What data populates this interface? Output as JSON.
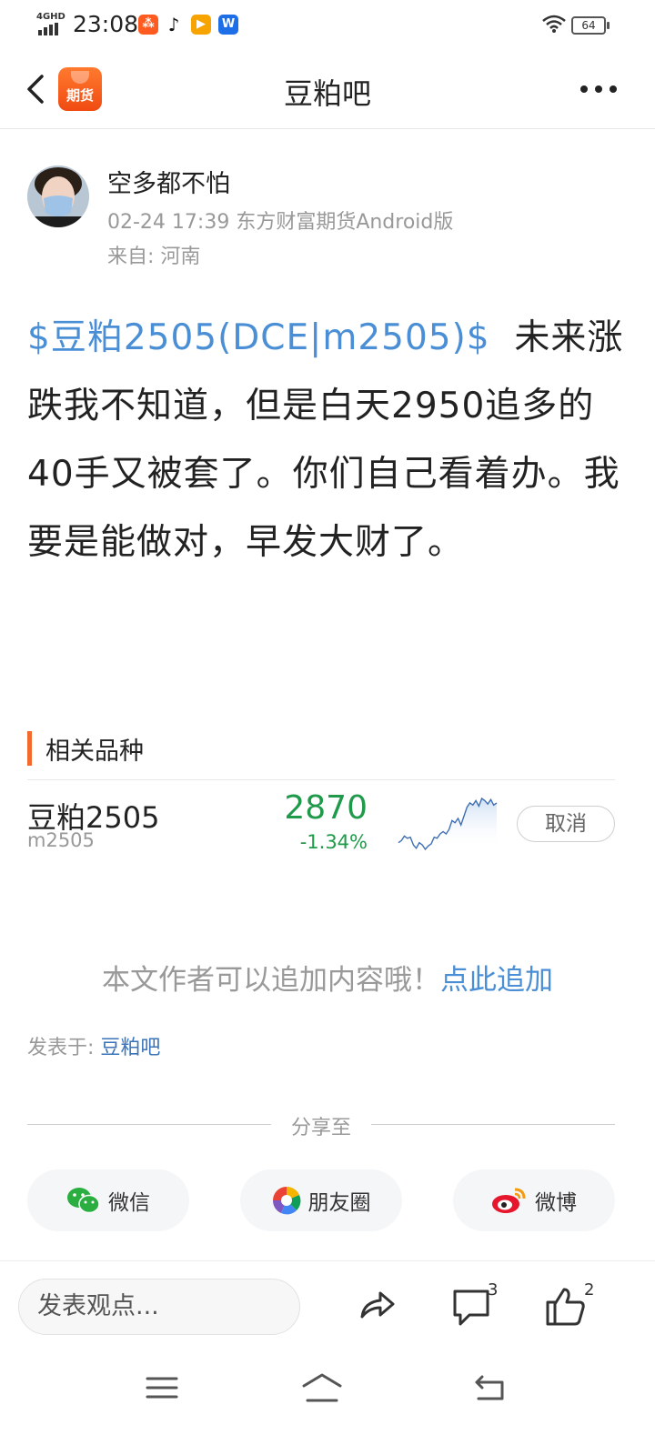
{
  "status_bar": {
    "network": "4GHD",
    "time": "23:08",
    "battery": "64",
    "apps": [
      {
        "name": "kuaishou-icon",
        "glyph": "⁂",
        "color": "#ff5a1f"
      },
      {
        "name": "tiktok-icon",
        "glyph": "♪",
        "color": "#111111"
      },
      {
        "name": "video-app-icon",
        "glyph": "▶",
        "color": "#f7a400"
      },
      {
        "name": "w-app-icon",
        "glyph": "W",
        "color": "#1e6ee8"
      }
    ]
  },
  "header": {
    "title": "豆粕吧",
    "logo_text": "期货"
  },
  "post": {
    "author": "空多都不怕",
    "meta": "02-24 17:39 东方财富期货Android版",
    "location": "来自: 河南",
    "stock_link": "$豆粕2505(DCE|m2505)$",
    "content": "未来涨跌我不知道，但是白天2950追多的40手又被套了。你们自己看着办。我要是能做对，早发大财了。"
  },
  "related": {
    "title": "相关品种",
    "name": "豆粕2505",
    "code": "m2505",
    "price": "2870",
    "change": "-1.34%",
    "cancel_label": "取消",
    "sparkline": [
      50,
      48,
      44,
      46,
      45,
      52,
      55,
      50,
      52,
      56,
      53,
      51,
      45,
      46,
      42,
      40,
      42,
      38,
      30,
      32,
      28,
      34,
      26,
      18,
      14,
      16,
      12,
      17,
      10,
      12,
      15,
      11,
      16,
      14
    ]
  },
  "append": {
    "text": "本文作者可以追加内容哦！",
    "link": "点此追加"
  },
  "posted_in": {
    "label": "发表于: ",
    "forum": "豆粕吧"
  },
  "share": {
    "label": "分享至",
    "wechat": "微信",
    "moments": "朋友圈",
    "weibo": "微博"
  },
  "bottom_bar": {
    "placeholder": "发表观点...",
    "comment_count": "3",
    "like_count": "2"
  }
}
